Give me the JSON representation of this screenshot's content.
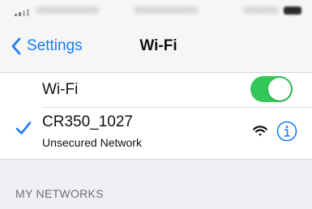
{
  "status_bar": {
    "carrier": "",
    "time": "",
    "battery": ""
  },
  "nav": {
    "back_label": "Settings",
    "title": "Wi-Fi"
  },
  "wifi_toggle": {
    "label": "Wi-Fi",
    "on": true,
    "color": "#34c759"
  },
  "current_network": {
    "name": "CR350_1027",
    "status": "Unsecured Network",
    "connected": true,
    "icons": [
      "checkmark-icon",
      "wifi-signal-icon",
      "info-icon"
    ]
  },
  "sections": {
    "my_networks_header": "MY NETWORKS"
  },
  "colors": {
    "accent": "#1a7cf5",
    "background": "#efeff4"
  }
}
